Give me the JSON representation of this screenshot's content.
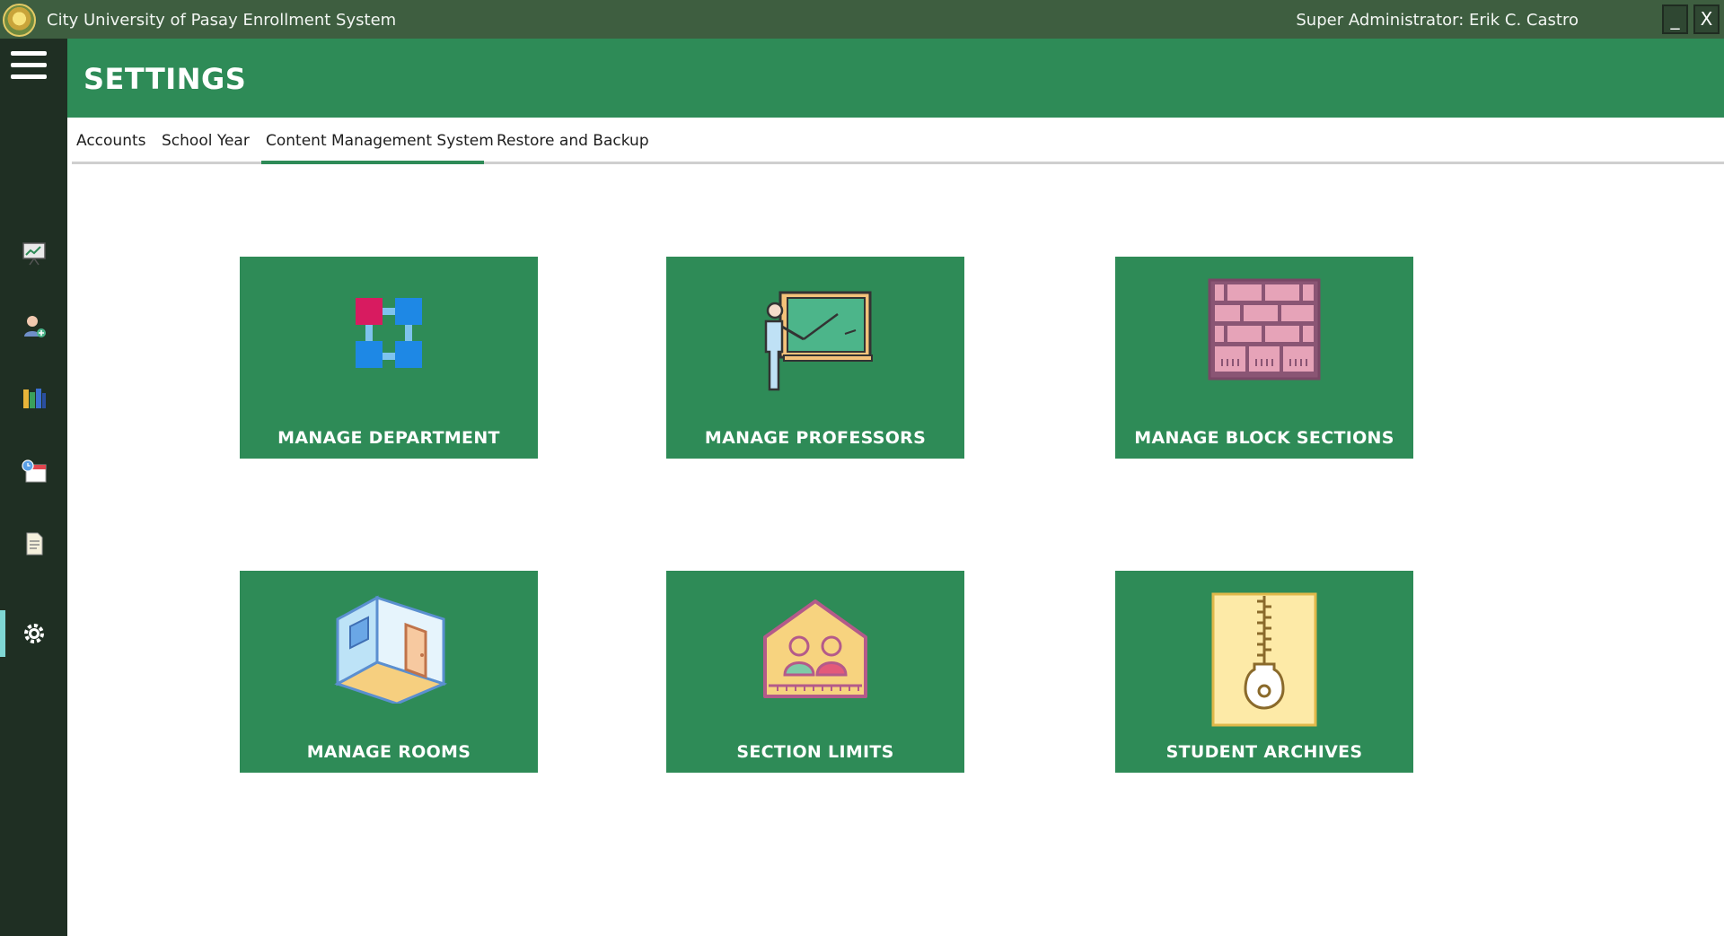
{
  "window": {
    "title": "City University of Pasay Enrollment System",
    "user": "Super Administrator: Erik C. Castro",
    "minimize": "_",
    "close": "X"
  },
  "header": {
    "title": "SETTINGS"
  },
  "tabs": [
    {
      "label": "Accounts"
    },
    {
      "label": "School Year"
    },
    {
      "label": "Content Management System",
      "active": true
    },
    {
      "label": "Restore and Backup"
    }
  ],
  "sidebar": {
    "items": [
      {
        "icon": "presentation-chart-icon"
      },
      {
        "icon": "add-user-icon"
      },
      {
        "icon": "books-icon"
      },
      {
        "icon": "calendar-clock-icon"
      },
      {
        "icon": "document-icon"
      },
      {
        "icon": "gear-icon",
        "active": true
      }
    ]
  },
  "cards": [
    {
      "label": "MANAGE DEPARTMENT",
      "icon": "department-structure-icon"
    },
    {
      "label": "MANAGE PROFESSORS",
      "icon": "teacher-board-icon"
    },
    {
      "label": "MANAGE BLOCK SECTIONS",
      "icon": "brick-wall-icon"
    },
    {
      "label": "MANAGE ROOMS",
      "icon": "room-icon"
    },
    {
      "label": "SECTION LIMITS",
      "icon": "house-people-icon"
    },
    {
      "label": "STUDENT ARCHIVES",
      "icon": "zip-archive-icon"
    }
  ],
  "colors": {
    "titlebar": "#3e5e40",
    "sidebar": "#1f2f23",
    "accent_green": "#2e8b57",
    "active_indicator": "#7fd7d4"
  }
}
